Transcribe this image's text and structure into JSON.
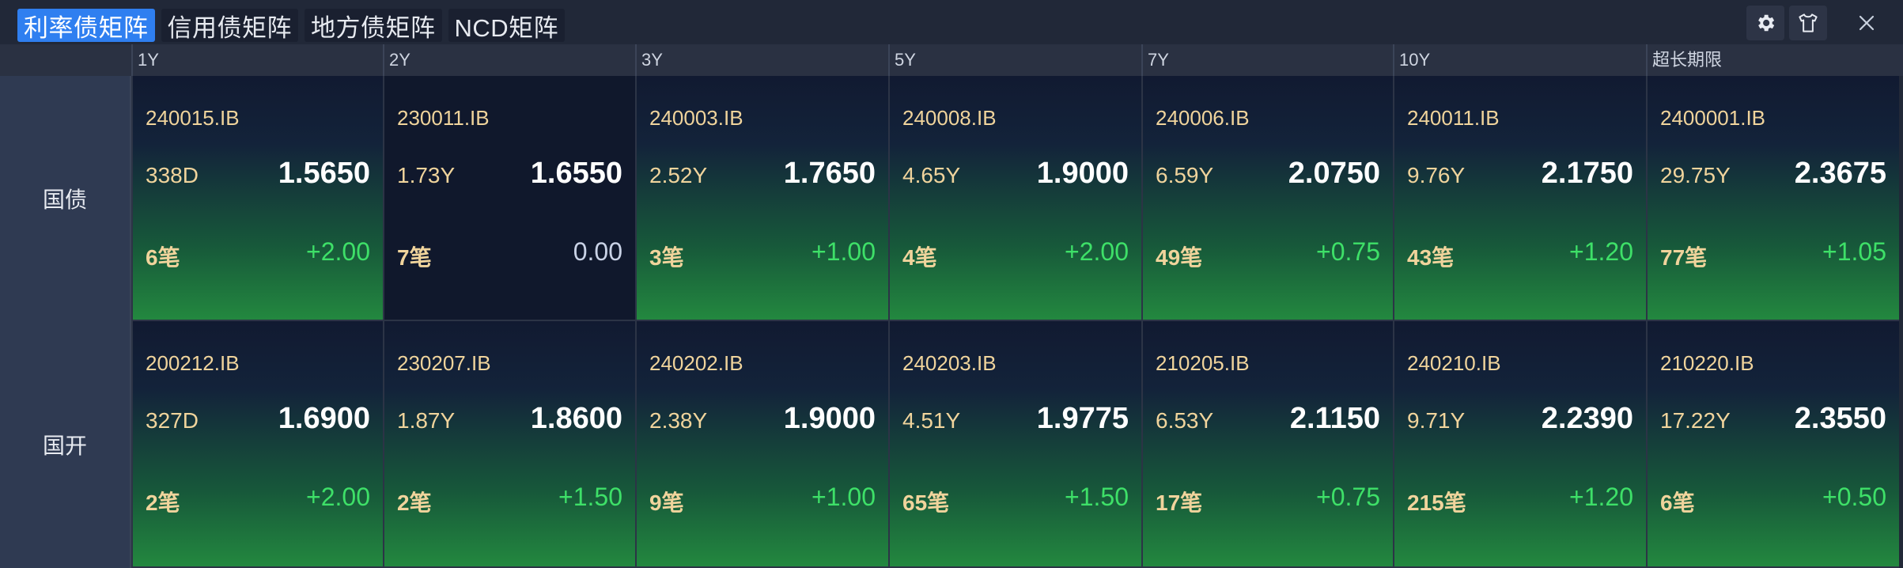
{
  "tabs": [
    {
      "label": "利率债矩阵",
      "active": true
    },
    {
      "label": "信用债矩阵",
      "active": false
    },
    {
      "label": "地方债矩阵",
      "active": false
    },
    {
      "label": "NCD矩阵",
      "active": false
    }
  ],
  "toolbar": {
    "settings_icon": "gear-icon",
    "theme_icon": "shirt-icon",
    "close_icon": "close-icon"
  },
  "columns": [
    "1Y",
    "2Y",
    "3Y",
    "5Y",
    "7Y",
    "10Y",
    "超长期限"
  ],
  "rows": [
    {
      "label": "国债",
      "cells": [
        {
          "code": "240015.IB",
          "term": "338D",
          "yield": "1.5650",
          "count": "6笔",
          "change": "+2.00"
        },
        {
          "code": "230011.IB",
          "term": "1.73Y",
          "yield": "1.6550",
          "count": "7笔",
          "change": "0.00"
        },
        {
          "code": "240003.IB",
          "term": "2.52Y",
          "yield": "1.7650",
          "count": "3笔",
          "change": "+1.00"
        },
        {
          "code": "240008.IB",
          "term": "4.65Y",
          "yield": "1.9000",
          "count": "4笔",
          "change": "+2.00"
        },
        {
          "code": "240006.IB",
          "term": "6.59Y",
          "yield": "2.0750",
          "count": "49笔",
          "change": "+0.75"
        },
        {
          "code": "240011.IB",
          "term": "9.76Y",
          "yield": "2.1750",
          "count": "43笔",
          "change": "+1.20"
        },
        {
          "code": "2400001.IB",
          "term": "29.75Y",
          "yield": "2.3675",
          "count": "77笔",
          "change": "+1.05"
        }
      ]
    },
    {
      "label": "国开",
      "cells": [
        {
          "code": "200212.IB",
          "term": "327D",
          "yield": "1.6900",
          "count": "2笔",
          "change": "+2.00"
        },
        {
          "code": "230207.IB",
          "term": "1.87Y",
          "yield": "1.8600",
          "count": "2笔",
          "change": "+1.50"
        },
        {
          "code": "240202.IB",
          "term": "2.38Y",
          "yield": "1.9000",
          "count": "9笔",
          "change": "+1.00"
        },
        {
          "code": "240203.IB",
          "term": "4.51Y",
          "yield": "1.9775",
          "count": "65笔",
          "change": "+1.50"
        },
        {
          "code": "210205.IB",
          "term": "6.53Y",
          "yield": "2.1150",
          "count": "17笔",
          "change": "+0.75"
        },
        {
          "code": "240210.IB",
          "term": "9.71Y",
          "yield": "2.2390",
          "count": "215笔",
          "change": "+1.20"
        },
        {
          "code": "210220.IB",
          "term": "17.22Y",
          "yield": "2.3550",
          "count": "6笔",
          "change": "+0.50"
        }
      ]
    }
  ]
}
